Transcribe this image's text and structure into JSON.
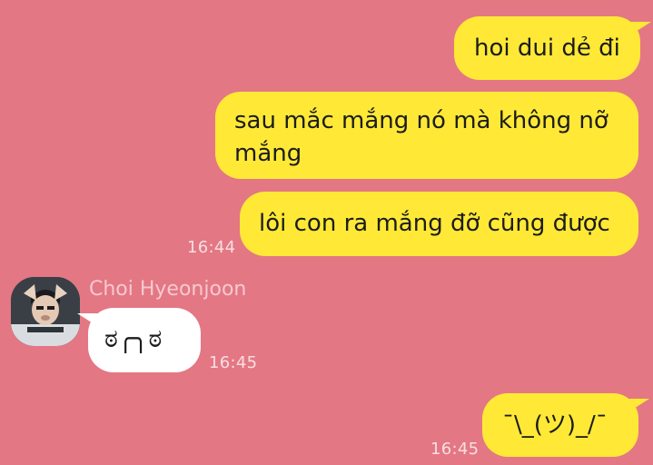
{
  "colors": {
    "background": "#e47784",
    "outgoing_bubble": "#ffe936",
    "incoming_bubble": "#ffffff"
  },
  "messages": {
    "out1": {
      "text": "hoi dui dẻ đi"
    },
    "out2": {
      "text": "sau mắc mắng nó mà không nỡ mắng"
    },
    "out3": {
      "text": "lôi con ra mắng đỡ cũng được"
    },
    "out_group_time": "16:44",
    "incoming": {
      "sender": "Choi Hyeonjoon",
      "text": "ಠ╭╮ಠ",
      "time": "16:45"
    },
    "out4": {
      "text": "¯\\_(ツ)_/¯",
      "time": "16:45"
    }
  }
}
